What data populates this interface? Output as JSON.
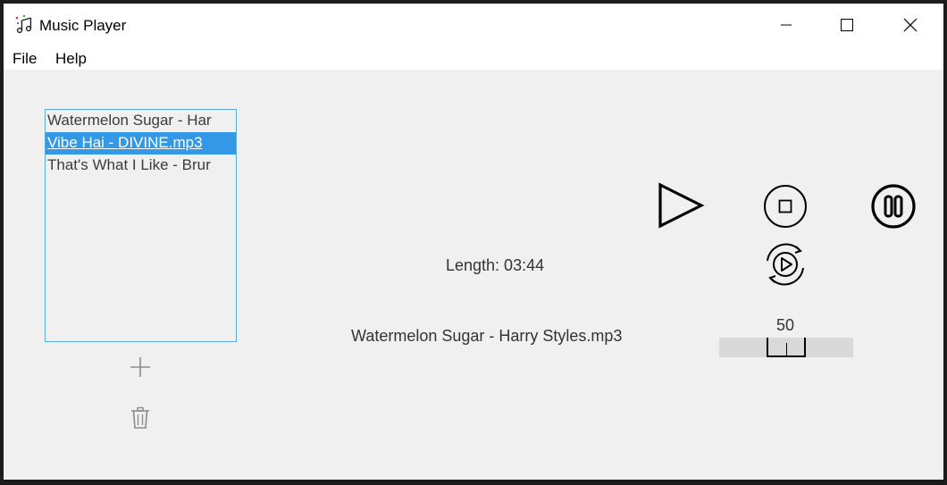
{
  "window": {
    "title": "Music Player",
    "icons": {
      "app": "music-notes-icon",
      "minimize": "minimize-icon",
      "maximize": "maximize-icon",
      "close": "close-icon"
    }
  },
  "menu": {
    "file_label": "File",
    "help_label": "Help"
  },
  "playlist": {
    "items": [
      {
        "label": "Watermelon Sugar - Har",
        "selected": false
      },
      {
        "label": "Vibe Hai - DIVINE.mp3",
        "selected": true
      },
      {
        "label": "That's What I Like - Brur",
        "selected": false
      }
    ],
    "add_icon": "plus-icon",
    "delete_icon": "trash-icon"
  },
  "player": {
    "length_text": "Length: 03:44",
    "current_track": "Watermelon Sugar - Harry Styles.mp3",
    "volume_value": "50",
    "volume_level": 50,
    "controls": {
      "play_icon": "play-icon",
      "stop_icon": "stop-icon",
      "pause_icon": "pause-icon",
      "replay_icon": "replay-icon"
    }
  },
  "colors": {
    "selection": "#3399e6",
    "list_border": "#5aa9d6",
    "window_bg": "#f0f0f0"
  }
}
